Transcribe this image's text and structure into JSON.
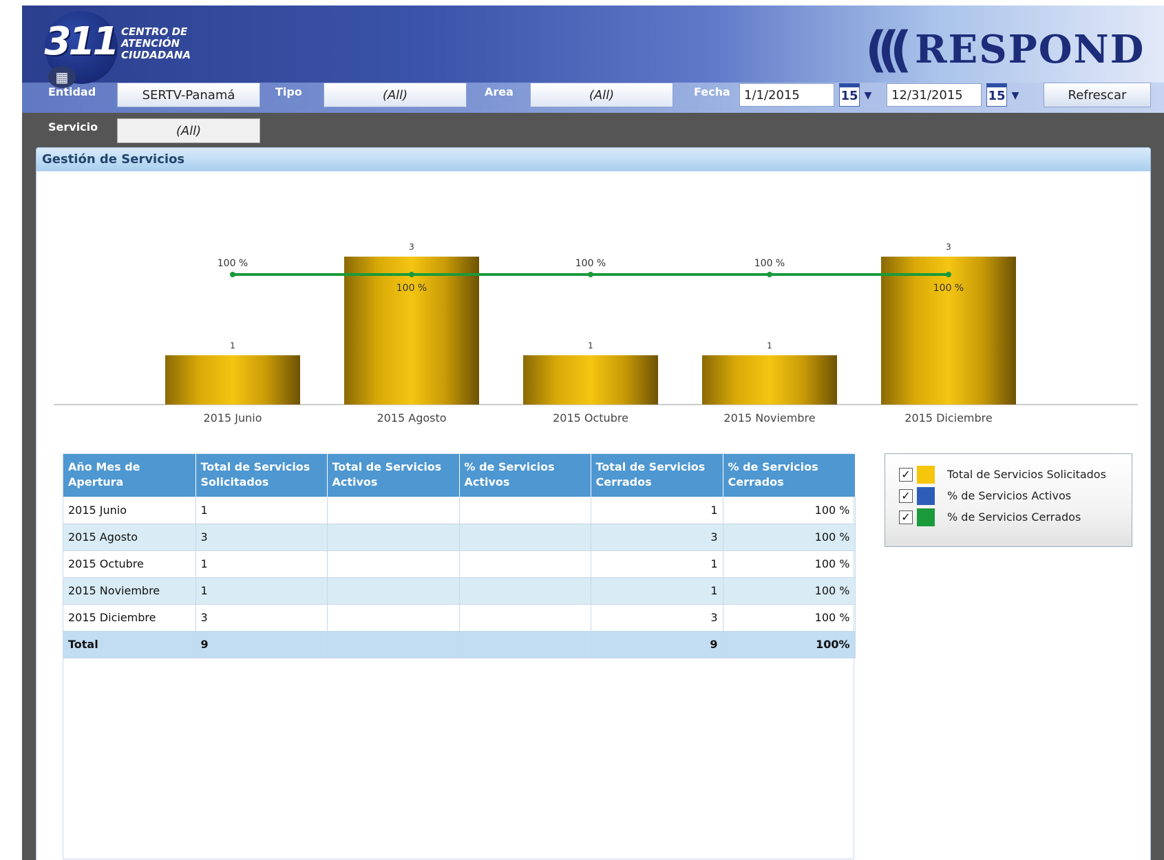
{
  "header": {
    "logo_number": "311",
    "logo_lines": [
      "CENTRO DE",
      "ATENCIÓN",
      "CIUDADANA"
    ],
    "brand_waves": "(((",
    "brand_word": "RESPOND"
  },
  "filters": {
    "entidad_label": "Entidad",
    "entidad_value": "SERTV-Panamá",
    "tipo_label": "Tipo",
    "tipo_value": "(All)",
    "area_label": "Area",
    "area_value": "(All)",
    "fecha_label": "Fecha",
    "fecha_from": "1/1/2015",
    "fecha_to": "12/31/2015",
    "calendar_day": "15",
    "refresh_label": "Refrescar",
    "servicio_label": "Servicio",
    "servicio_value": "(All)"
  },
  "panel": {
    "title": "Gestión de Servicios"
  },
  "chart_data": {
    "type": "bar",
    "categories": [
      "2015 Junio",
      "2015 Agosto",
      "2015 Octubre",
      "2015 Noviembre",
      "2015 Diciembre"
    ],
    "series": [
      {
        "name": "Total de Servicios Solicitados",
        "kind": "bar",
        "values": [
          1,
          3,
          1,
          1,
          3
        ],
        "labels": [
          "1",
          "3",
          "1",
          "1",
          "3"
        ]
      },
      {
        "name": "% de Servicios Cerrados",
        "kind": "line",
        "values": [
          100,
          100,
          100,
          100,
          100
        ],
        "labels": [
          "100 %",
          "100 %",
          "100 %",
          "100 %",
          "100 %"
        ]
      }
    ],
    "colors": {
      "bar": "#e8b810",
      "line": "#1a9a3a"
    }
  },
  "table": {
    "headers": [
      "Año Mes de Apertura",
      "Total de Servicios Solicitados",
      "Total de Servicios Activos",
      "% de Servicios Activos",
      "Total de Servicios Cerrados",
      "% de Servicios Cerrados"
    ],
    "rows": [
      [
        "2015 Junio",
        "1",
        "",
        "",
        "1",
        "100 %"
      ],
      [
        "2015 Agosto",
        "3",
        "",
        "",
        "3",
        "100 %"
      ],
      [
        "2015 Octubre",
        "1",
        "",
        "",
        "1",
        "100 %"
      ],
      [
        "2015 Noviembre",
        "1",
        "",
        "",
        "1",
        "100 %"
      ],
      [
        "2015 Diciembre",
        "3",
        "",
        "",
        "3",
        "100 %"
      ]
    ],
    "total": [
      "Total",
      "9",
      "",
      "",
      "9",
      "100%"
    ]
  },
  "legend": {
    "items": [
      {
        "label": "Total de Servicios Solicitados",
        "color": "#f6c60c",
        "checked": "✓"
      },
      {
        "label": "% de Servicios Activos",
        "color": "#2e5db8",
        "checked": "✓"
      },
      {
        "label": "% de Servicios Cerrados",
        "color": "#1a9a3a",
        "checked": "✓"
      }
    ]
  }
}
